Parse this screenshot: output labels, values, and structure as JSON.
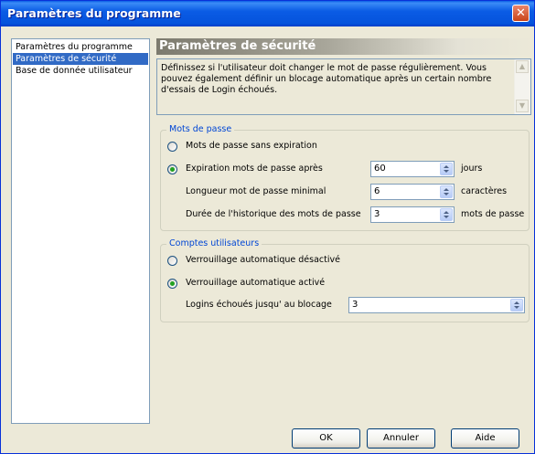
{
  "window": {
    "title": "Paramètres du programme"
  },
  "nav": {
    "items": [
      {
        "label": "Paramètres du programme",
        "selected": false
      },
      {
        "label": "Paramètres de sécurité",
        "selected": true
      },
      {
        "label": "Base de donnée utilisateur",
        "selected": false
      }
    ]
  },
  "section": {
    "title": "Paramètres de sécurité",
    "description": "Définissez si l'utilisateur doit changer le mot de passe régulièrement. Vous pouvez également définir un blocage automatique après un certain nombre d'essais de Login échoués."
  },
  "passwords": {
    "legend": "Mots de passe",
    "radio_no_expiry": {
      "label": "Mots de passe sans expiration",
      "checked": false
    },
    "radio_expiry": {
      "label": "Expiration mots de passe après",
      "checked": true,
      "value": "60",
      "unit": "jours"
    },
    "min_length": {
      "label": "Longueur mot de passe minimal",
      "value": "6",
      "unit": "caractères"
    },
    "history": {
      "label": "Durée de l'historique des mots de passe",
      "value": "3",
      "unit": "mots de passe"
    }
  },
  "accounts": {
    "legend": "Comptes utilisateurs",
    "radio_lock_off": {
      "label": "Verrouillage automatique désactivé",
      "checked": false
    },
    "radio_lock_on": {
      "label": "Verrouillage automatique activé",
      "checked": true
    },
    "failed_logins": {
      "label": "Logins échoués jusqu' au blocage",
      "value": "3"
    }
  },
  "buttons": {
    "ok": "OK",
    "cancel": "Annuler",
    "help": "Aide"
  },
  "colors": {
    "title_bar": "#0553dc",
    "selection": "#316ac5",
    "group_legend": "#0046d5",
    "radio_dot": "#21a121"
  }
}
